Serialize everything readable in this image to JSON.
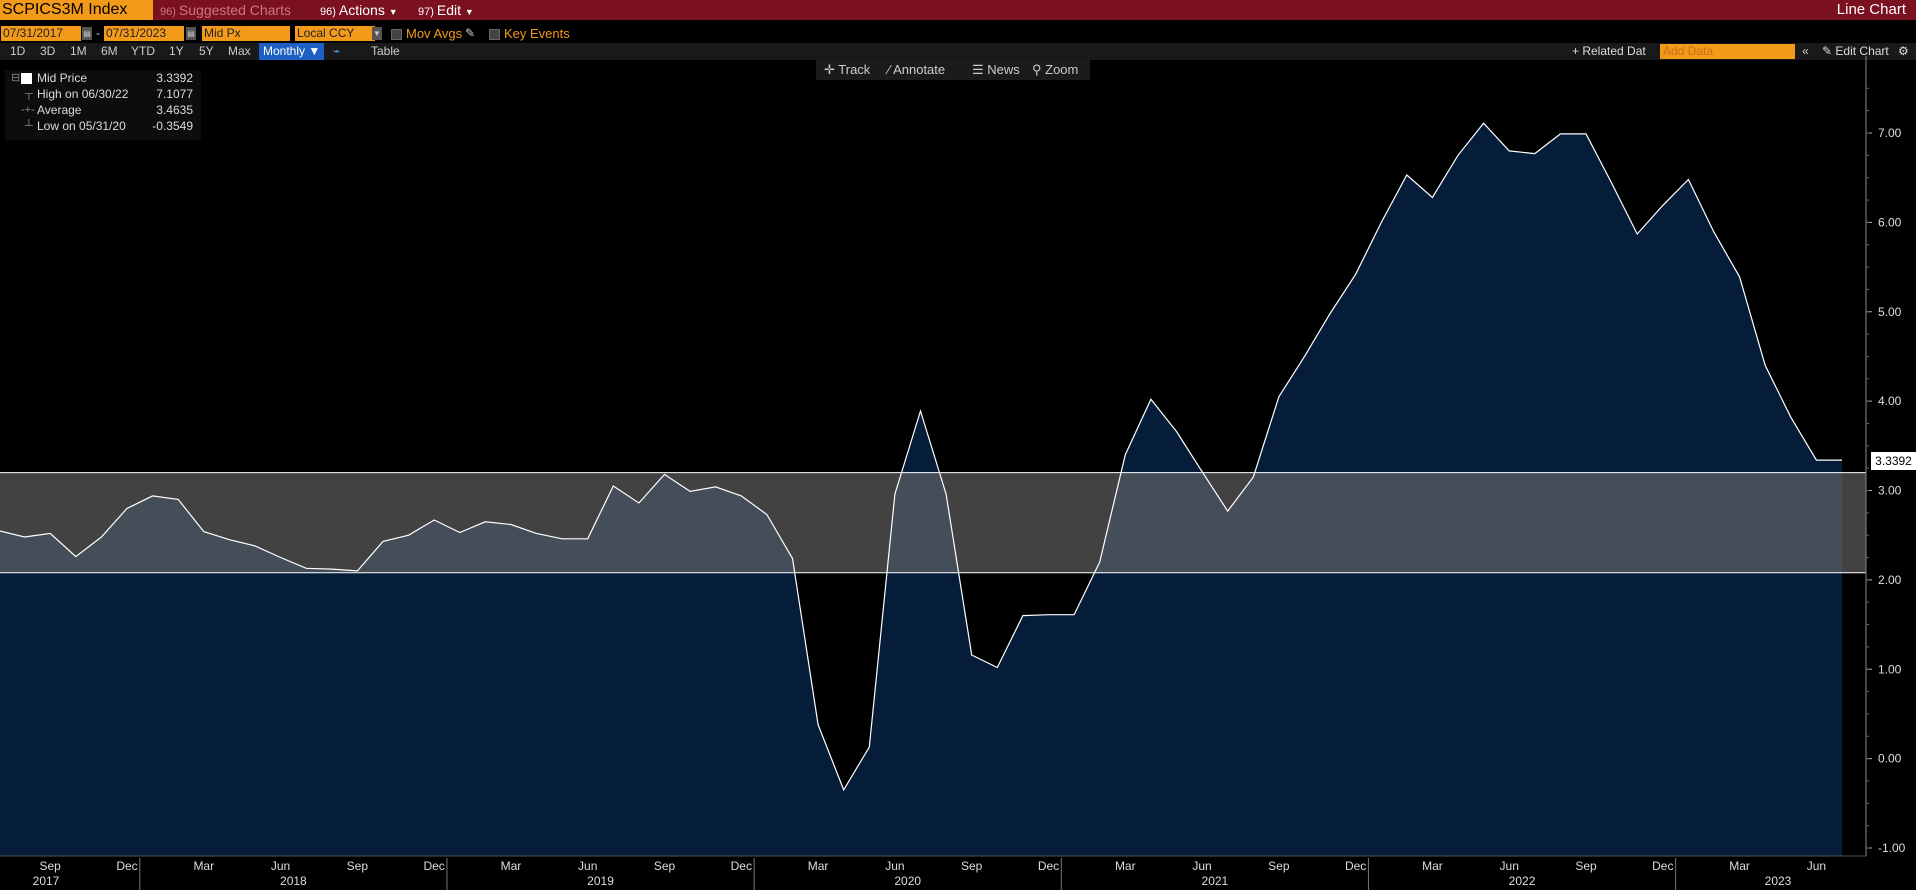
{
  "header": {
    "ticker": "SCPICS3M Index",
    "menu_suggested": "Suggested Charts",
    "menu_suggested_num": "96)",
    "menu_actions": "Actions",
    "menu_actions_num": "96)",
    "menu_edit": "Edit",
    "menu_edit_num": "97)",
    "chart_type": "Line Chart"
  },
  "controls": {
    "start_date": "07/31/2017",
    "end_date": "07/31/2023",
    "price_field": "Mid Px",
    "currency": "Local CCY",
    "mov_avgs": "Mov Avgs",
    "key_events": "Key Events",
    "periods": [
      "1D",
      "3D",
      "1M",
      "6M",
      "YTD",
      "1Y",
      "5Y",
      "Max"
    ],
    "frequency": "Monthly ▼",
    "table": "Table",
    "related_data": "+ Related Dat",
    "add_data_placeholder": "Add Data",
    "edit_chart": "Edit Chart"
  },
  "toolbar": {
    "track": "Track",
    "annotate": "Annotate",
    "news": "News",
    "zoom": "Zoom"
  },
  "legend": {
    "rows": [
      {
        "name": "Mid Price",
        "value": "3.3392"
      },
      {
        "name": "High on 06/30/22",
        "value": "7.1077"
      },
      {
        "name": "Average",
        "value": "3.4635"
      },
      {
        "name": "Low on 05/31/20",
        "value": "-0.3549"
      }
    ]
  },
  "last_value_label": "3.3392",
  "colors": {
    "header": "#7a1020",
    "accent": "#f39a1a",
    "area": "#061d3a",
    "band": "#6a6a6a",
    "line": "#ffffff"
  },
  "chart_data": {
    "type": "area",
    "series": [
      {
        "name": "Mid Price",
        "x": [
          "2017-07",
          "2017-08",
          "2017-09",
          "2017-10",
          "2017-11",
          "2017-12",
          "2018-01",
          "2018-02",
          "2018-03",
          "2018-04",
          "2018-05",
          "2018-06",
          "2018-07",
          "2018-08",
          "2018-09",
          "2018-10",
          "2018-11",
          "2018-12",
          "2019-01",
          "2019-02",
          "2019-03",
          "2019-04",
          "2019-05",
          "2019-06",
          "2019-07",
          "2019-08",
          "2019-09",
          "2019-10",
          "2019-11",
          "2019-12",
          "2020-01",
          "2020-02",
          "2020-03",
          "2020-04",
          "2020-05",
          "2020-06",
          "2020-07",
          "2020-08",
          "2020-09",
          "2020-10",
          "2020-11",
          "2020-12",
          "2021-01",
          "2021-02",
          "2021-03",
          "2021-04",
          "2021-05",
          "2021-06",
          "2021-07",
          "2021-08",
          "2021-09",
          "2021-10",
          "2021-11",
          "2021-12",
          "2022-01",
          "2022-02",
          "2022-03",
          "2022-04",
          "2022-05",
          "2022-06",
          "2022-07",
          "2022-08",
          "2022-09",
          "2022-10",
          "2022-11",
          "2022-12",
          "2023-01",
          "2023-02",
          "2023-03",
          "2023-04",
          "2023-05",
          "2023-06",
          "2023-07"
        ],
        "values": [
          2.55,
          2.48,
          2.52,
          2.26,
          2.48,
          2.8,
          2.94,
          2.9,
          2.54,
          2.45,
          2.38,
          2.25,
          2.13,
          2.12,
          2.1,
          2.43,
          2.5,
          2.67,
          2.53,
          2.65,
          2.62,
          2.52,
          2.46,
          2.46,
          3.05,
          2.86,
          3.18,
          2.99,
          3.04,
          2.94,
          2.73,
          2.24,
          0.38,
          -0.35,
          0.13,
          2.96,
          3.89,
          2.96,
          1.16,
          1.02,
          1.6,
          1.61,
          1.61,
          2.2,
          3.4,
          4.02,
          3.66,
          3.21,
          2.77,
          3.15,
          4.05,
          4.5,
          4.98,
          5.42,
          6.0,
          6.53,
          6.28,
          6.75,
          7.11,
          6.8,
          6.77,
          6.99,
          6.99,
          6.44,
          5.87,
          6.19,
          6.48,
          5.89,
          5.39,
          4.4,
          3.82,
          3.34,
          3.34
        ]
      }
    ],
    "reference_band": {
      "low": 2.08,
      "high": 3.2
    },
    "ylim": [
      -1.0,
      7.7
    ],
    "yticks": [
      "-1.00",
      "0.00",
      "1.00",
      "2.00",
      "3.00",
      "4.00",
      "5.00",
      "6.00",
      "7.00"
    ],
    "month_ticks": [
      "Sep",
      "Dec",
      "Mar",
      "Jun",
      "Sep",
      "Dec",
      "Mar",
      "Jun",
      "Sep",
      "Dec",
      "Mar",
      "Jun",
      "Sep",
      "Dec",
      "Mar",
      "Jun",
      "Sep",
      "Dec",
      "Mar",
      "Jun",
      "Sep",
      "Dec",
      "Mar",
      "Jun"
    ],
    "year_ticks": [
      "2017",
      "2018",
      "2019",
      "2020",
      "2021",
      "2022",
      "2023"
    ],
    "grid": false,
    "legend_position": "top-left"
  }
}
